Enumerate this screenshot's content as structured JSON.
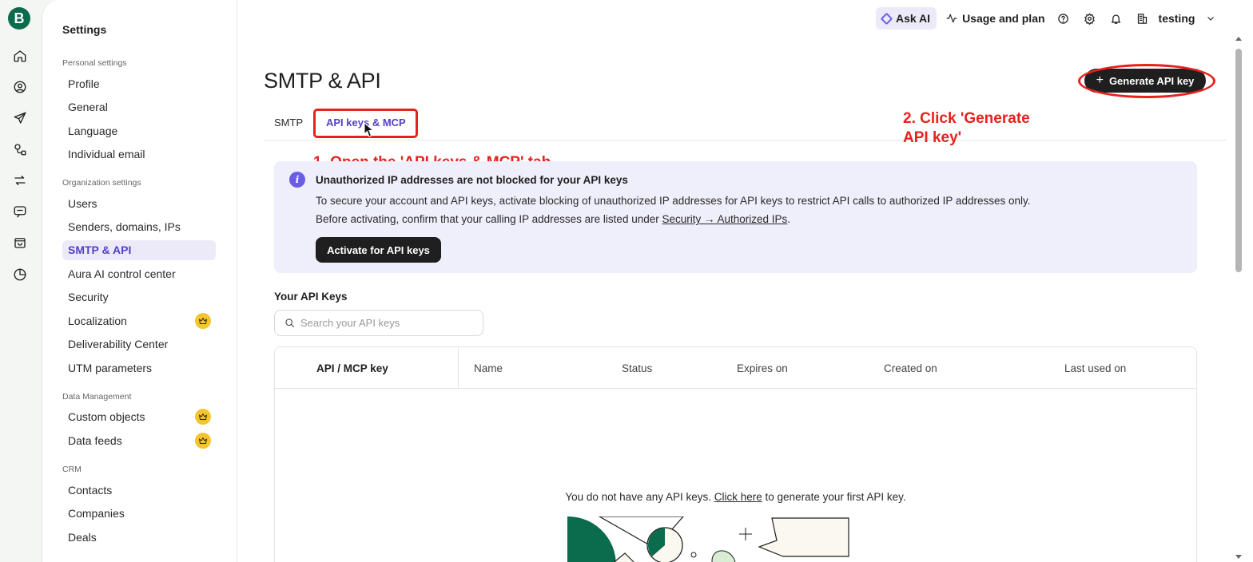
{
  "rail": {
    "logo_letter": "B",
    "icons": [
      "home-icon",
      "contacts-icon",
      "campaigns-icon",
      "automations-icon",
      "transactional-icon",
      "conversations-icon",
      "ecommerce-icon",
      "reports-icon"
    ]
  },
  "sidebar": {
    "title": "Settings",
    "sections": [
      {
        "label": "Personal settings",
        "items": [
          "Profile",
          "General",
          "Language",
          "Individual email"
        ]
      },
      {
        "label": "Organization settings",
        "items": [
          "Users",
          "Senders, domains, IPs",
          "SMTP & API",
          "Aura AI control center",
          "Security",
          "Localization",
          "Deliverability Center",
          "UTM parameters"
        ]
      },
      {
        "label": "Data Management",
        "items": [
          "Custom objects",
          "Data feeds"
        ]
      },
      {
        "label": "CRM",
        "items": [
          "Contacts",
          "Companies",
          "Deals"
        ]
      }
    ],
    "active_item": "SMTP & API",
    "premium_items": [
      "Localization",
      "Custom objects",
      "Data feeds"
    ]
  },
  "topbar": {
    "ask_ai": "Ask AI",
    "usage": "Usage and plan",
    "account": "testing"
  },
  "main": {
    "title": "SMTP & API",
    "generate_button": "Generate API key",
    "tabs": [
      "SMTP",
      "API keys & MCP"
    ],
    "active_tab": "API keys & MCP"
  },
  "annotations": {
    "step1": "1. Open the 'API keys & MCP' tab",
    "step2_line1": "2. Click 'Generate",
    "step2_line2": "API key'",
    "color": "#e8211d"
  },
  "info": {
    "title": "Unauthorized IP addresses are not blocked for your API keys",
    "line1": "To secure your account and API keys, activate blocking of unauthorized IP addresses for API keys to restrict API calls to authorized IP addresses only.",
    "line2_prefix": "Before activating, confirm that your calling IP addresses are listed under ",
    "line2_link": "Security → Authorized IPs",
    "line2_suffix": ".",
    "button": "Activate for API keys"
  },
  "keys": {
    "heading": "Your API Keys",
    "search_placeholder": "Search your API keys",
    "columns": [
      "API / MCP key",
      "Name",
      "Status",
      "Expires on",
      "Created on",
      "Last used on"
    ],
    "empty_prefix": "You do not have any API keys. ",
    "empty_link": "Click here",
    "empty_suffix": " to generate your first API key."
  },
  "colors": {
    "brand": "#0b6b4d",
    "accent": "#5142c6",
    "info_bg": "#efeefb",
    "premium": "#f4c431"
  }
}
